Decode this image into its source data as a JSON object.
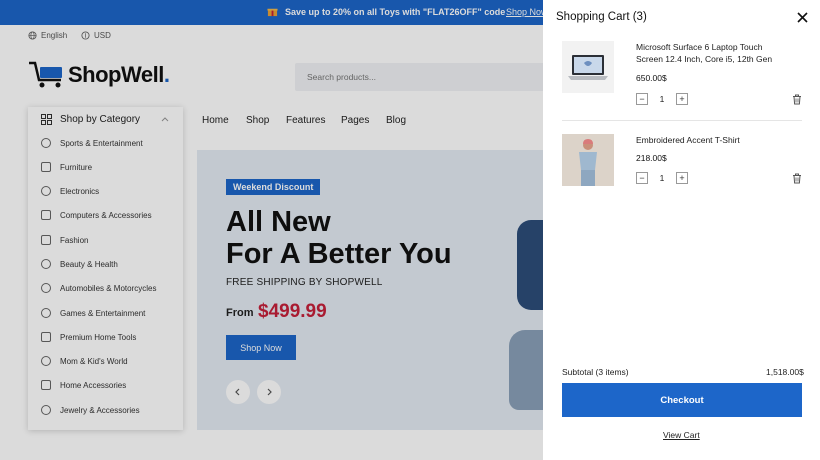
{
  "promo": {
    "text": "Save up to 20% on all Toys with \"FLAT26OFF\" code",
    "link": "Shop Now"
  },
  "utility": {
    "language": "English",
    "currency": "USD"
  },
  "brand": {
    "name": "ShopWell",
    "dot": ".",
    "accent": "#1d66c9"
  },
  "search": {
    "placeholder": "Search products..."
  },
  "categories": {
    "heading": "Shop by Category",
    "items": [
      "Sports & Entertainment",
      "Furniture",
      "Electronics",
      "Computers & Accessories",
      "Fashion",
      "Beauty & Health",
      "Automobiles & Motorcycles",
      "Games & Entertainment",
      "Premium Home Tools",
      "Mom & Kid's World",
      "Home Accessories",
      "Jewelry & Accessories"
    ]
  },
  "nav": [
    "Home",
    "Shop",
    "Features",
    "Pages",
    "Blog"
  ],
  "hero": {
    "badge": "Weekend Discount",
    "title_line1": "All New",
    "title_line2": "For A Better You",
    "subtitle": "FREE SHIPPING BY SHOPWELL",
    "from_label": "From",
    "price": "$499.99",
    "button": "Shop Now",
    "price_color": "#c5203a"
  },
  "cart": {
    "title": "Shopping Cart (3)",
    "items": [
      {
        "name": "Microsoft Surface 6 Laptop Touch Screen 12.4 Inch, Core i5, 12th Gen",
        "price": "650.00$",
        "qty": "1",
        "icon": "laptop-image"
      },
      {
        "name": "Embroidered Accent T-Shirt",
        "price": "218.00$",
        "qty": "1",
        "icon": "tshirt-model-image"
      }
    ],
    "subtotal_label": "Subtotal (3 items)",
    "subtotal_value": "1,518.00$",
    "checkout": "Checkout",
    "view_cart": "View Cart"
  }
}
